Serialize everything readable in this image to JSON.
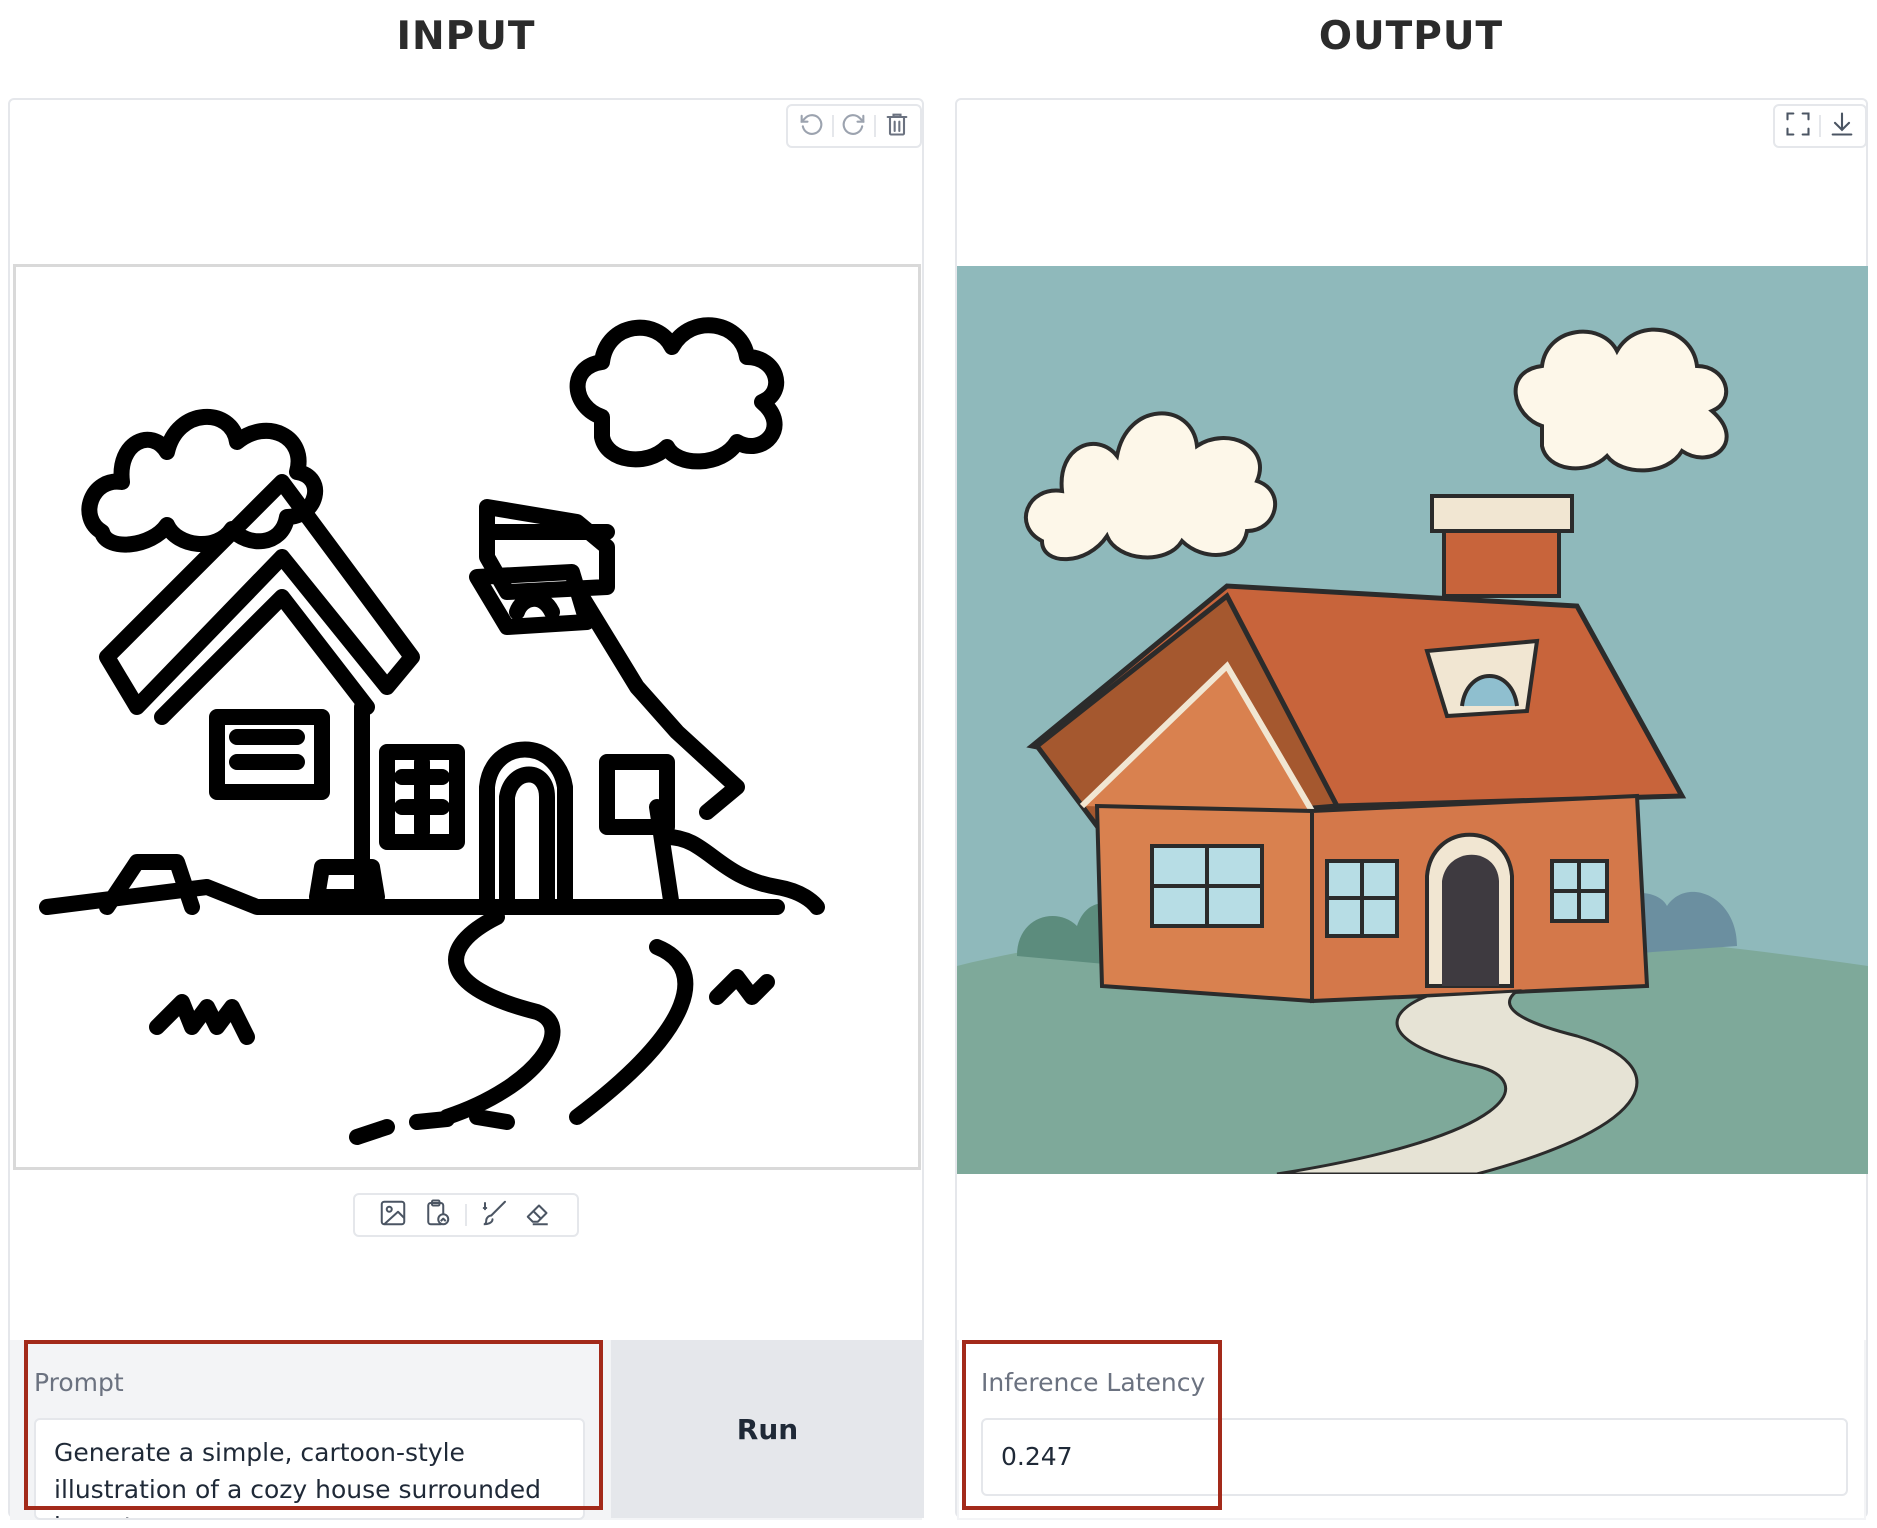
{
  "headings": {
    "input": "INPUT",
    "output": "OUTPUT"
  },
  "input_panel": {
    "toolbar_icons": [
      "undo-icon",
      "redo-icon",
      "trash-icon"
    ],
    "edit_tool_icons": [
      "image-upload-icon",
      "clipboard-paste-icon",
      "brush-icon",
      "eraser-icon"
    ],
    "prompt": {
      "label": "Prompt",
      "value": "Generate a simple, cartoon-style illustration of a cozy house surrounded by nature."
    },
    "run_label": "Run"
  },
  "output_panel": {
    "toolbar_icons": [
      "fullscreen-icon",
      "download-icon"
    ],
    "latency": {
      "label": "Inference Latency",
      "value": "0.247"
    }
  },
  "colors": {
    "highlight": "#a32a1a",
    "sky": "#8fb9bb",
    "roof": "#c8643b",
    "wall": "#d9814f",
    "grass": "#7ea99a"
  }
}
